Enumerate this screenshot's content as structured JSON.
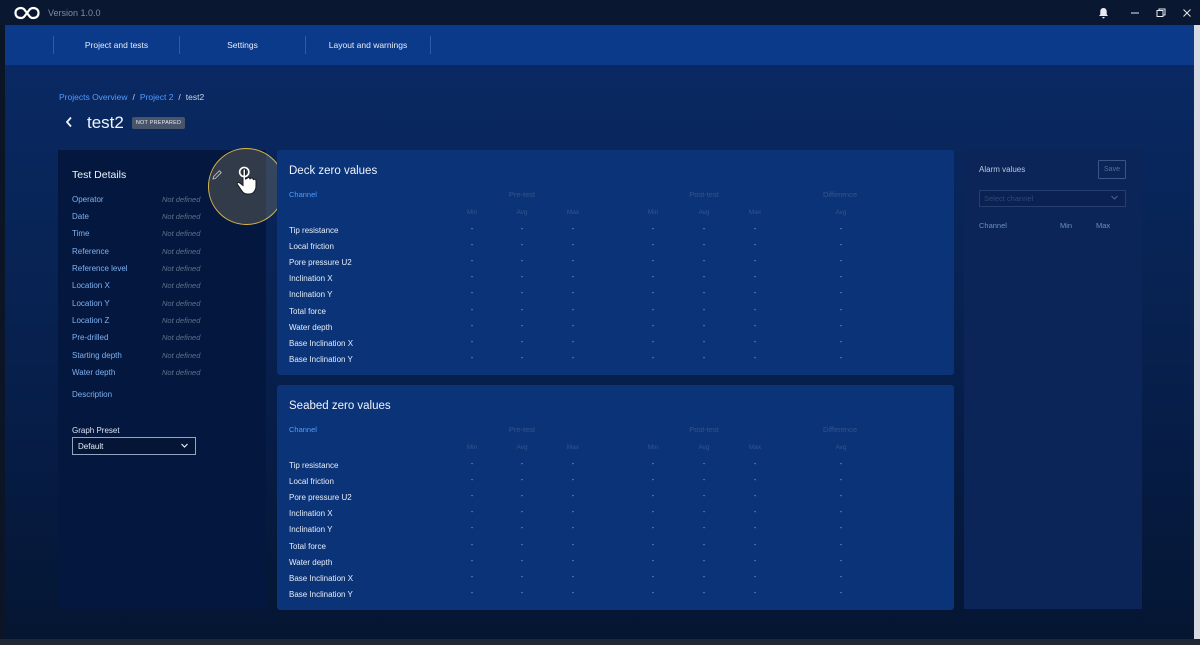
{
  "titlebar": {
    "version": "Version 1.0.0",
    "icons": [
      "infinity-logo-icon",
      "bell-icon",
      "minimize-icon",
      "restore-icon",
      "close-icon"
    ]
  },
  "nav": {
    "tabs": [
      {
        "label": "Project and tests"
      },
      {
        "label": "Settings"
      },
      {
        "label": "Layout and warnings"
      }
    ]
  },
  "breadcrumb": {
    "items": [
      "Projects Overview",
      "Project 2",
      "test2"
    ],
    "separator": "/"
  },
  "header": {
    "title": "test2",
    "status": "NOT PREPARED"
  },
  "test_details": {
    "title": "Test Details",
    "fields": [
      {
        "label": "Operator",
        "value": "Not defined"
      },
      {
        "label": "Date",
        "value": "Not defined"
      },
      {
        "label": "Time",
        "value": "Not defined"
      },
      {
        "label": "Reference",
        "value": "Not defined"
      },
      {
        "label": "Reference level",
        "value": "Not defined"
      },
      {
        "label": "Location X",
        "value": "Not defined"
      },
      {
        "label": "Location Y",
        "value": "Not defined"
      },
      {
        "label": "Location Z",
        "value": "Not defined"
      },
      {
        "label": "Pre-drilled",
        "value": "Not defined"
      },
      {
        "label": "Starting depth",
        "value": "Not defined"
      },
      {
        "label": "Water depth",
        "value": "Not defined"
      }
    ],
    "description_label": "Description",
    "graph_preset": {
      "label": "Graph Preset",
      "value": "Default"
    }
  },
  "zero_tables": {
    "columns": {
      "channel": "Channel",
      "groups": [
        "Pre-test",
        "Post-test",
        "Difference"
      ],
      "sub": [
        "Min",
        "Avg",
        "Max",
        "Min",
        "Avg",
        "Max",
        "Avg"
      ]
    },
    "channels": [
      "Tip resistance",
      "Local friction",
      "Pore pressure U2",
      "Inclination X",
      "Inclination Y",
      "Total force",
      "Water depth",
      "Base Inclination X",
      "Base Inclination Y"
    ],
    "empty_value": "-",
    "deck": {
      "title": "Deck zero values"
    },
    "seabed": {
      "title": "Seabed zero values"
    }
  },
  "alarm": {
    "title": "Alarm values",
    "save_label": "Save",
    "select_placeholder": "Select channel",
    "columns": [
      "Channel",
      "Min",
      "Max"
    ]
  }
}
